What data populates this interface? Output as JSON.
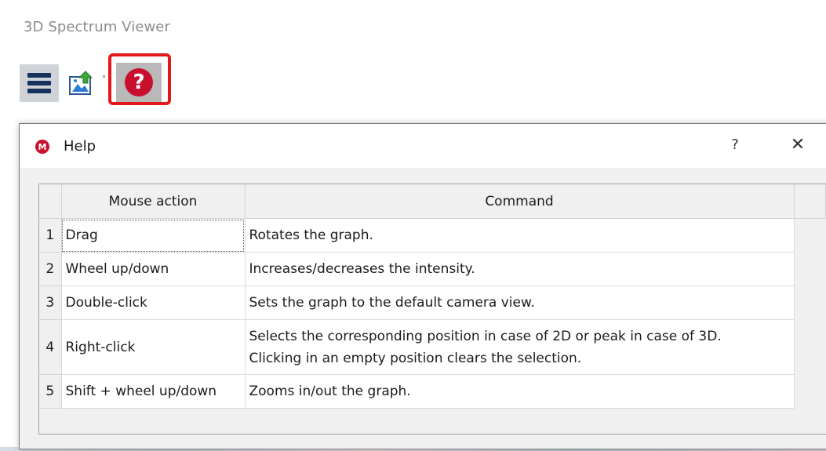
{
  "app": {
    "title": "3D Spectrum Viewer"
  },
  "toolbar": {
    "menu_icon": "hamburger-menu-icon",
    "export_icon": "export-image-icon",
    "help_icon": "help-circle-icon",
    "help_glyph": "?",
    "highlight_color": "#e31818"
  },
  "dialog": {
    "title": "Help",
    "help_button": "?",
    "close_button": "✕",
    "icon_glyph": "M"
  },
  "table": {
    "columns": [
      "Mouse action",
      "Command"
    ],
    "rows": [
      {
        "num": "1",
        "action": "Drag",
        "command": "Rotates the graph."
      },
      {
        "num": "2",
        "action": "Wheel up/down",
        "command": "Increases/decreases the intensity."
      },
      {
        "num": "3",
        "action": "Double-click",
        "command": "Sets the graph to the default camera view."
      },
      {
        "num": "4",
        "action": "Right-click",
        "command": "Selects the corresponding position in case of 2D or peak in case of 3D.",
        "command_line2": "Clicking in an empty position clears the selection."
      },
      {
        "num": "5",
        "action": "Shift + wheel up/down",
        "command": "Zooms in/out the graph."
      }
    ]
  },
  "colors": {
    "accent_red": "#c8102e",
    "menu_icon_color": "#15315e"
  }
}
